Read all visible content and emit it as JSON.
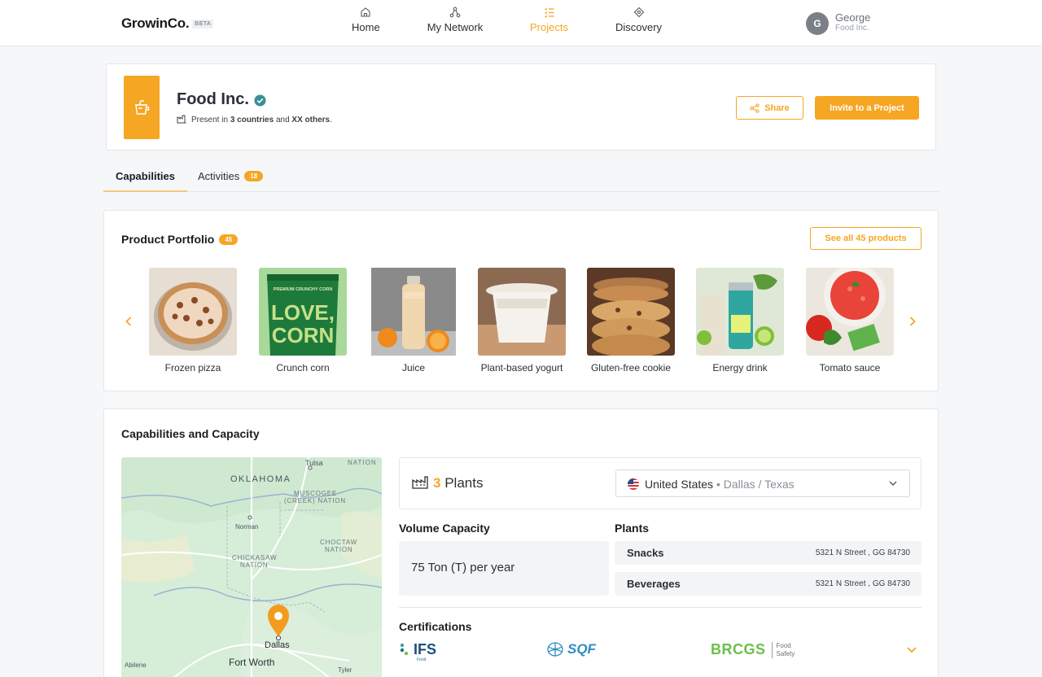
{
  "header": {
    "logo": "GrowinCo.",
    "beta": "BETA",
    "nav": [
      {
        "label": "Home",
        "icon": "home-icon"
      },
      {
        "label": "My Network",
        "icon": "network-icon"
      },
      {
        "label": "Projects",
        "icon": "projects-icon",
        "active": true
      },
      {
        "label": "Discovery",
        "icon": "discovery-icon"
      }
    ],
    "user": {
      "initial": "G",
      "name": "George",
      "company": "Food Inc."
    }
  },
  "company": {
    "name": "Food Inc.",
    "meta_prefix": "Present in ",
    "meta_countries": "3 countries",
    "meta_and": " and ",
    "meta_others": "XX others",
    "meta_suffix": ".",
    "share_label": "Share",
    "invite_label": "Invite to a Project"
  },
  "tabs": [
    {
      "label": "Capabilities",
      "active": true
    },
    {
      "label": "Activities",
      "badge": "18"
    }
  ],
  "portfolio": {
    "title": "Product Portfolio",
    "count": "45",
    "see_all_label": "See all 45 products",
    "products": [
      {
        "name": "Frozen pizza"
      },
      {
        "name": "Crunch corn"
      },
      {
        "name": "Juice"
      },
      {
        "name": "Plant-based yogurt"
      },
      {
        "name": "Gluten-free cookie"
      },
      {
        "name": "Energy drink"
      },
      {
        "name": "Tomato sauce"
      }
    ],
    "packaging_text": {
      "tag": "PREMIUM CRUNCHY CORN",
      "line1": "LOVE,",
      "line2": "CORN"
    }
  },
  "capabilities": {
    "title": "Capabilities and Capacity",
    "plants_count": "3",
    "plants_label": "Plants",
    "location_country": "United States",
    "location_sep": " • ",
    "location_region": "Dallas / Texas",
    "volume_title": "Volume Capacity",
    "volume_value": "75 Ton (T) per year",
    "plants_title": "Plants",
    "plants": [
      {
        "name": "Snacks",
        "address": "5321 N  Street , GG 84730"
      },
      {
        "name": "Beverages",
        "address": "5321 N  Street , GG 84730"
      }
    ],
    "certifications_title": "Certifications",
    "certifications": [
      {
        "name": "IFS",
        "sub": "Food"
      },
      {
        "name": "SQF"
      },
      {
        "name": "BRCGS",
        "sub1": "Food",
        "sub2": "Safety"
      }
    ]
  },
  "map": {
    "labels": {
      "oklahoma": "OKLAHOMA",
      "tulsa": "Tulsa",
      "nation_top": "NATION",
      "muscogee": "MUSCOGEE",
      "creek": "(CREEK) NATION",
      "norman": "Norman",
      "choctaw1": "CHOCTAW",
      "choctaw2": "NATION",
      "chickasaw1": "CHICKASAW",
      "chickasaw2": "NATION",
      "dallas": "Dallas",
      "fortworth": "Fort Worth",
      "abilene": "Abilene",
      "tyler": "Tyler"
    }
  },
  "colors": {
    "accent": "#f5a623",
    "verified": "#3b8f95",
    "map_bg": "#d8efdc"
  }
}
